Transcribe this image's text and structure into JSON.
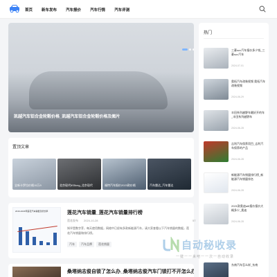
{
  "header": {
    "nav": [
      "首页",
      "新车发布",
      "汽车报价",
      "汽车行情",
      "汽车评测"
    ]
  },
  "hero": {
    "title": "凯越汽车铝合金轮毂价格_凯越汽车铝合金轮毂价格及图片"
  },
  "recommended": {
    "title": "置顶文章",
    "items": [
      {
        "caption": "全新卡罗拉价格15万9"
      },
      {
        "caption": "北京现代6S5cng_北京现代"
      },
      {
        "caption": "福特汽车报价2023款价格"
      },
      {
        "caption": "汽车雷达_汽车雷达"
      }
    ]
  },
  "article1": {
    "title": "莲花汽车销量_莲花汽车销量排行榜",
    "author": "莲花发布",
    "date": "2024-10-28",
    "views": "57",
    "excerpt": "知乎是数字芽，每天使用数据，网络中已经有多款新能源汽车，请大家查看以下汽车销量的数据，莲花汽车销量和排行榜。",
    "tags": [
      "汽车",
      "汽车品牌",
      "莲花销量"
    ],
    "thumb_title": "2016-2023年莲花汽车销量及增长率"
  },
  "article2": {
    "title": "桑塔纳志俊自锁了怎么办_桑塔纳志俊汽车门锁打不开怎么办"
  },
  "sidebar": {
    "title": "热门",
    "items": [
      {
        "text": "三菱suv汽车报价多少钱_三菱suv汽车",
        "date": "2024-07-01"
      },
      {
        "text": "奥拓汽车改装视频 奥拓汽车改装视频",
        "date": "2024-06-29"
      },
      {
        "text": "丰田系列越野车最好开的车_丰田系列越野车",
        "date": "2024-06-28"
      },
      {
        "text": "吉利汽车保养项目_吉利汽车保养的产品",
        "date": "2024-06-28"
      },
      {
        "text": "新能源汽车销量排行榜_新能源汽车销量排名",
        "date": "2024-06-28"
      },
      {
        "text": "2021款奥迪a6l报价报价大概多少_奥迪",
        "date": "2024-06-28"
      },
      {
        "text": "东南汽车怎么样_东南",
        "date": "2024-06-28"
      }
    ]
  },
  "watermark": {
    "main": "自动秘收录",
    "sub": "一键一一来吧一一次一自动收录"
  }
}
